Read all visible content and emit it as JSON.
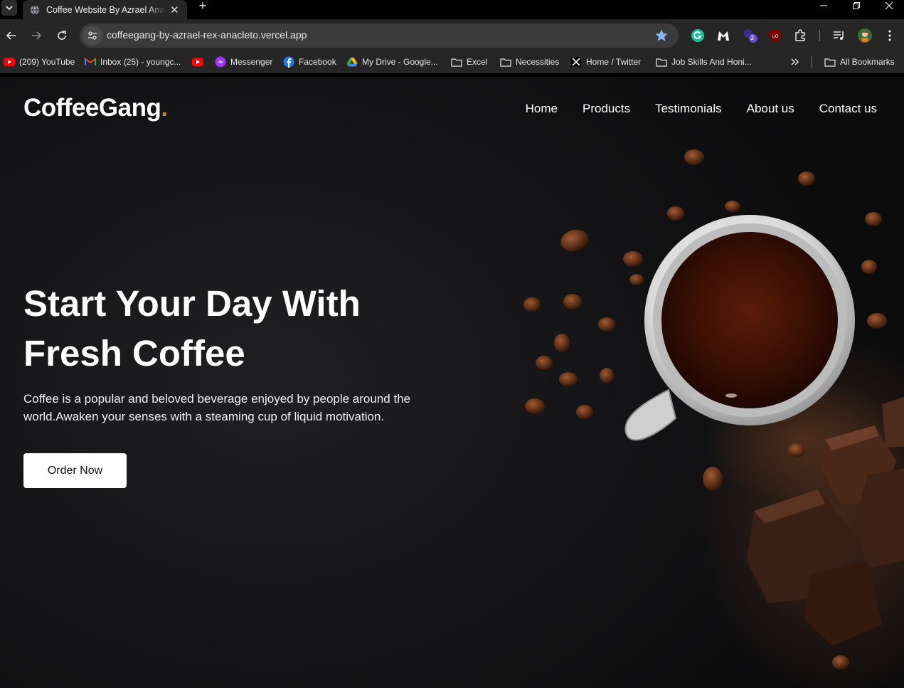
{
  "browser": {
    "tab_title": "Coffee Website By Azrael Anacleto",
    "url": "coffeegang-by-azrael-rex-anacleto.vercel.app",
    "extension_badge": "3",
    "bookmarks": [
      {
        "label": "(209) YouTube",
        "icon": "youtube-icon"
      },
      {
        "label": "Inbox (25) - youngc...",
        "icon": "gmail-icon"
      },
      {
        "label": "",
        "icon": "youtube-icon"
      },
      {
        "label": "Messenger",
        "icon": "messenger-icon"
      },
      {
        "label": "Facebook",
        "icon": "facebook-icon"
      },
      {
        "label": "My Drive - Google...",
        "icon": "google-drive-icon"
      },
      {
        "label": "Excel",
        "icon": "folder-icon"
      },
      {
        "label": "Necessities",
        "icon": "folder-icon"
      },
      {
        "label": "Home / Twitter",
        "icon": "x-twitter-icon"
      },
      {
        "label": "Job Skills And Honi...",
        "icon": "folder-icon"
      }
    ],
    "all_bookmarks": "All Bookmarks"
  },
  "site": {
    "logo": "CoffeeGang",
    "logo_dot": ".",
    "nav": [
      "Home",
      "Products",
      "Testimonials",
      "About us",
      "Contact us"
    ],
    "hero": {
      "title_line1": "Start Your Day With",
      "title_line2": "Fresh Coffee",
      "description": "Coffee is a popular and beloved beverage enjoyed by people around the world.Awaken your senses with a steaming cup of liquid motivation.",
      "cta": "Order Now"
    },
    "accent_color": "#c87b3a"
  }
}
